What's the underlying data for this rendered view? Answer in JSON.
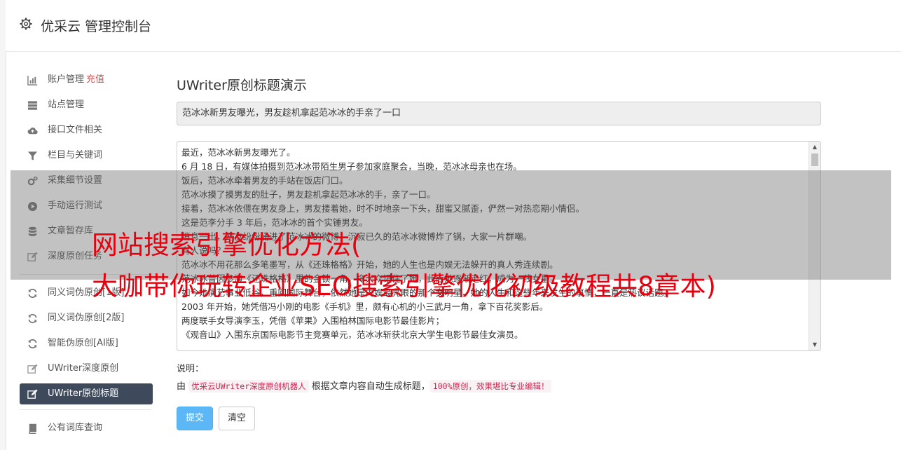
{
  "header": {
    "title": "优采云 管理控制台"
  },
  "sidebar": {
    "items": [
      {
        "label": "账户管理",
        "extra": "充值",
        "icon": "bar-chart-icon"
      },
      {
        "label": "站点管理",
        "icon": "server-icon"
      },
      {
        "label": "接口文件相关",
        "icon": "cloud-upload-icon"
      },
      {
        "label": "栏目与关键词",
        "icon": "filter-icon"
      },
      {
        "label": "采集细节设置",
        "icon": "gears-icon"
      },
      {
        "label": "手动运行测试",
        "icon": "play-circle-icon"
      },
      {
        "label": "文章暂存库",
        "icon": "database-icon"
      },
      {
        "label": "深度原创任务",
        "icon": "edit-icon"
      },
      {
        "label": "同义词伪原创[1版]",
        "icon": "refresh-icon"
      },
      {
        "label": "同义词伪原创[2版]",
        "icon": "refresh-icon"
      },
      {
        "label": "智能伪原创[AI版]",
        "icon": "refresh-icon"
      },
      {
        "label": "UWriter深度原创",
        "icon": "edit-icon"
      },
      {
        "label": "UWriter原创标题",
        "icon": "edit-icon",
        "active": true
      },
      {
        "label": "公有词库查询",
        "icon": "book-icon"
      }
    ]
  },
  "main": {
    "title": "UWriter原创标题演示",
    "title_value": "范冰冰新男友曝光，男友趁机拿起范冰冰的手亲了一口",
    "article_lines": [
      "最近，范冰冰新男友曝光了。",
      "6 月 18 日，有媒体拍摄到范冰冰带陌生男子参加家庭聚会，当晚，范冰冰母亲也在场。",
      "饭后，范冰冰牵着男友的手站在饭店门口。",
      "范冰冰摸了摸男友的肚子，男友趁机拿起范冰冰的手，亲了一口。",
      "接着，范冰冰依偎在男友身上，男友搂着她，时不时地亲一下头，甜蜜又腻歪，俨然一对热恋期小情侣。",
      "这是范李分手 3 年后，范冰冰的首个实锤男友。",
      "消息一出，网友纷纷涌进了范冰冰的微博，沉寂已久的范冰冰微博炸了锅，大家一片群嘲。",
      "有人说吗？",
      "范冰冰不用花那么多笔墨写，从《还珠格格》开始，她的人生也是内娱无法躲开的真人秀连续剧。",
      "范冰冰曾因参演《还珠格格》里的金锁一角，令大众记住了她，此后她逐渐走红，成为一线女星。",
      "如今她演艺事业低谷，重回国际舞台，依然她是内娱最亮眼的那个女明星，她的人生和这些年来发生的事情，一直是热议话题。",
      "2003 年开始，她凭借冯小刚的电影《手机》里，颇有心机的小三武月一角，拿下百花奖影后。",
      "两度联手女导演李玉，凭借《苹果》入围柏林国际电影节最佳影片；",
      "《观音山》入围东京国际电影节主竞赛单元，范冰冰斩获北京大学生电影节最佳女演员。"
    ],
    "note_label": "说明：",
    "note_prefix": "由",
    "note_code1": "优采云UWriter深度原创机器人",
    "note_middle": "根据文章内容自动生成标题，",
    "note_code2": "100%原创，效果堪比专业编辑！",
    "submit_label": "提交",
    "clear_label": "清空"
  },
  "overlay": {
    "line1": "网站搜索引擎优化方法(",
    "line2": "大咖带你玩转企业SEO搜索引擎优化初级教程共8章本)"
  }
}
